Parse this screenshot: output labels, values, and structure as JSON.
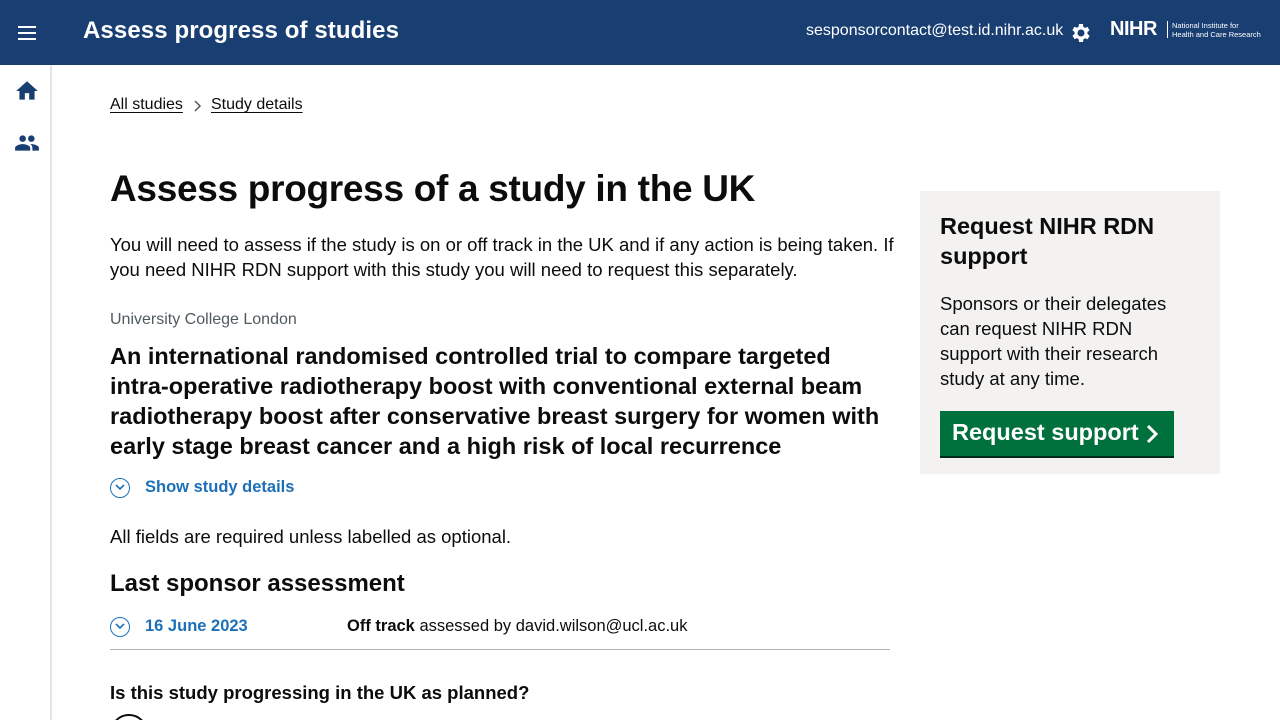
{
  "header": {
    "app_title": "Assess progress of studies",
    "user_email": "sesponsorcontact@test.id.nihr.ac.uk",
    "logo_mark": "NIHR",
    "logo_line1": "National Institute for",
    "logo_line2": "Health and Care Research"
  },
  "breadcrumb": {
    "items": [
      {
        "label": "All studies"
      },
      {
        "label": "Study details"
      }
    ]
  },
  "main": {
    "title": "Assess progress of a study in the UK",
    "intro": "You will need to assess if the study is on or off track in the UK and if any action is being taken. If you need NIHR RDN support with this study you will need to request this separately.",
    "organisation": "University College London",
    "study_title": "An international randomised controlled trial to compare targeted intra-operative radiotherapy boost with conventional external beam radiotherapy boost after conservative breast surgery for women with early stage breast cancer and a high risk of local recurrence",
    "show_details": "Show study details",
    "required_note": "All fields are required unless labelled as optional.",
    "last_assessment_heading": "Last sponsor assessment",
    "last_assessment": {
      "date": "16 June 2023",
      "status": "Off track",
      "assessed_by_text": " assessed by david.wilson@ucl.ac.uk"
    },
    "question": "Is this study progressing in the UK as planned?"
  },
  "aside": {
    "title": "Request NIHR RDN support",
    "body": "Sponsors or their delegates can request NIHR RDN support with their research study at any time.",
    "button_label": "Request support"
  },
  "colors": {
    "header_bg": "#193e72",
    "link_blue": "#1d70b8",
    "button_green": "#00703c",
    "aside_bg": "#f3f2f1"
  }
}
